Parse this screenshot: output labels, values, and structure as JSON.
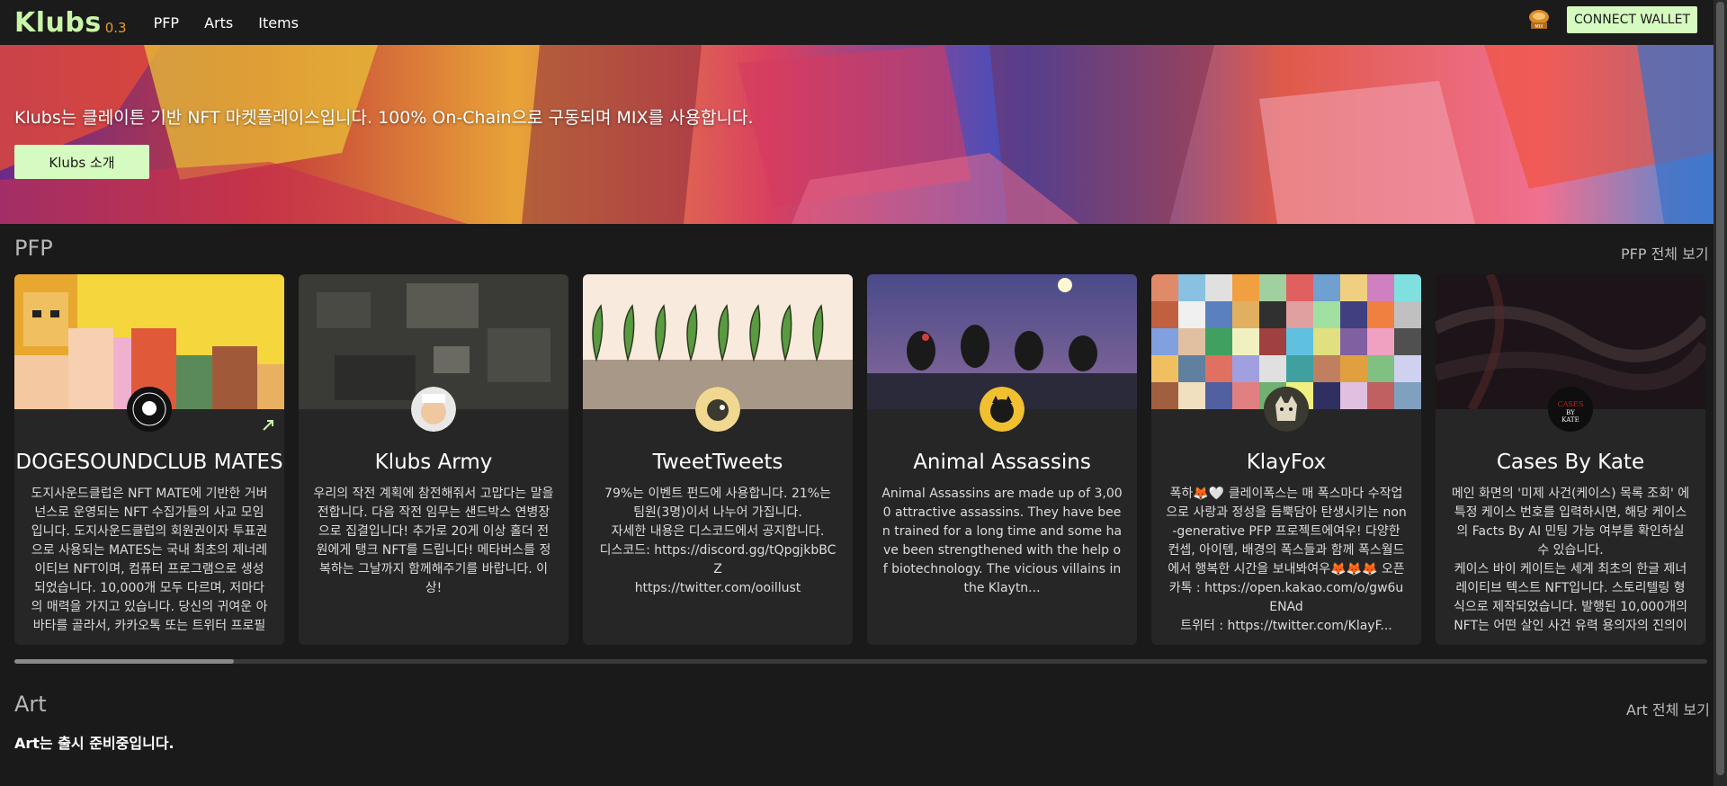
{
  "header": {
    "logo": "Klubs",
    "version": "0.3",
    "nav": [
      "PFP",
      "Arts",
      "Items"
    ],
    "mix_icon": "mix-token-icon",
    "wallet_label": "CONNECT WALLET"
  },
  "banner": {
    "text": "Klubs는 클레이튼 기반 NFT 마켓플레이스입니다. 100% On-Chain으로 구동되며 MIX를 사용합니다.",
    "button_label": "Klubs 소개"
  },
  "pfp": {
    "title": "PFP",
    "view_all": "PFP 전체 보기",
    "cards": [
      {
        "title": "DOGESOUNDCLUB MATES",
        "desc": "도지사운드클럽은 NFT MATE에 기반한 거버넌스로 운영되는 NFT 수집가들의 사교 모임입니다. 도지사운드클럽의 회원권이자 투표권으로 사용되는 MATES는 국내 최초의 제너레이티브 NFT이며, 컴퓨터 프로그램으로 생성되었습니다. 10,000개 모두 다르며, 저마다의 매력을 가지고 있습니다. 당신의 귀여운 아바타를 골라서, 카카오톡 또는 트위터 프로필로...",
        "external_icon": "external-link-icon"
      },
      {
        "title": "Klubs Army",
        "desc": "우리의 작전 계획에 참전해줘서 고맙다는 말을 전합니다. 다음 작전 임무는 샌드박스 연병장으로 집결입니다! 추가로 20게 이상 홀더 전원에게 탱크 NFT를 드립니다! 메타버스를 정복하는 그날까지 함께해주기를 바랍니다. 이상!"
      },
      {
        "title": "TweetTweets",
        "desc": "79%는 이벤트 펀드에 사용합니다. 21%는 팀원(3명)이서 나누어 가집니다.\n자세한 내용은 디스코드에서 공지합니다.\n디스코드: https://discord.gg/tQpgjkbBCZ\nhttps://twitter.com/ooillust"
      },
      {
        "title": "Animal Assassins",
        "desc": "Animal Assassins are made up of 3,000 attractive assassins. They have been trained for a long time and some have been strengthened with the help of biotechnology. The vicious villains in the Klaytn..."
      },
      {
        "title": "KlayFox",
        "desc": "폭하🦊🤍 클레이폭스는 매 폭스마다 수작업으로 사랑과 정성을 듬뿍담아 탄생시키는 non-generative PFP 프로젝트에여우! 다양한 컨셉, 아이템, 배경의 폭스들과 함께 폭스월드에서 행복한 시간을 보내봐여우🦊🦊🦊 오픈카톡 : https://open.kakao.com/o/gw6uENAd\n트위터 : https://twitter.com/KlayF..."
      },
      {
        "title": "Cases By Kate",
        "desc": "메인 화면의 '미제 사건(케이스) 목록 조회' 에 특정 케이스 번호를 입력하시면, 해당 케이스의 Facts By AI 민팅 가능 여부를 확인하실 수 있습니다.\n케이스 바이 케이트는 세계 최초의 한글 제너레이티브 텍스트 NFT입니다. 스토리텔링 형식으로 제작되었습니다. 발행된 10,000개의 NFT는 어떤 살인 사건 유력 용의자의 진의이 진술"
      }
    ]
  },
  "art": {
    "title": "Art",
    "view_all": "Art 전체 보기",
    "note": "Art는 출시 준비중입니다."
  }
}
